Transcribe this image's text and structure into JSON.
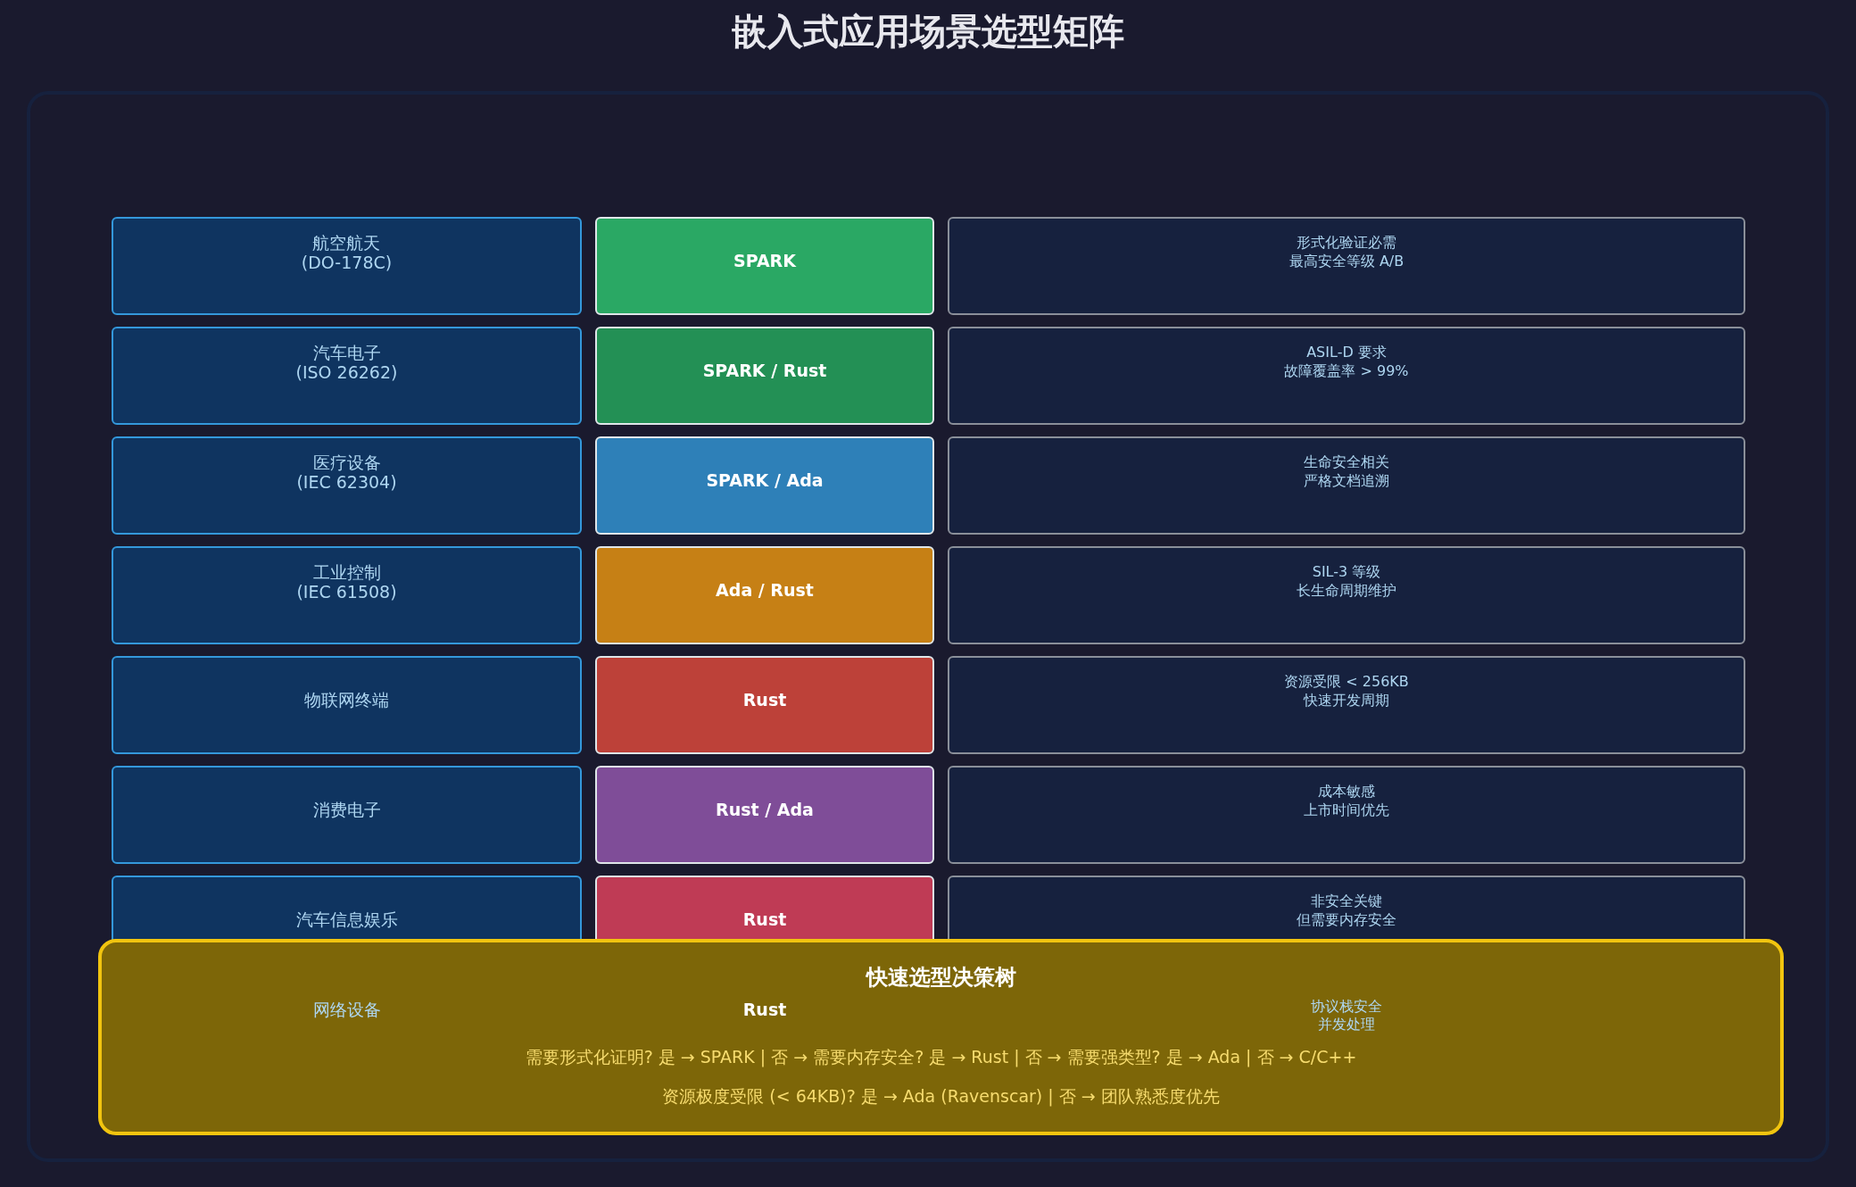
{
  "title": "嵌入式应用场景选型矩阵",
  "rows": [
    {
      "scenario": [
        "航空航天",
        "(DO-178C)"
      ],
      "choice": "SPARK",
      "color": "#2aa864",
      "notes": [
        "形式化验证必需",
        "最高安全等级 A/B"
      ]
    },
    {
      "scenario": [
        "汽车电子",
        "(ISO 26262)"
      ],
      "choice": "SPARK / Rust",
      "color": "#239055",
      "notes": [
        "ASIL-D 要求",
        "故障覆盖率 > 99%"
      ]
    },
    {
      "scenario": [
        "医疗设备",
        "(IEC 62304)"
      ],
      "choice": "SPARK / Ada",
      "color": "#2e80b8",
      "notes": [
        "生命安全相关",
        "严格文档追溯"
      ]
    },
    {
      "scenario": [
        "工业控制",
        "(IEC 61508)"
      ],
      "choice": "Ada / Rust",
      "color": "#c68015",
      "notes": [
        "SIL-3 等级",
        "长生命周期维护"
      ]
    },
    {
      "scenario": [
        "物联网终端"
      ],
      "choice": "Rust",
      "color": "#bd4139",
      "notes": [
        "资源受限 < 256KB",
        "快速开发周期"
      ]
    },
    {
      "scenario": [
        "消费电子"
      ],
      "choice": "Rust / Ada",
      "color": "#7f4d98",
      "notes": [
        "成本敏感",
        "上市时间优先"
      ]
    },
    {
      "scenario": [
        "汽车信息娱乐"
      ],
      "choice": "Rust",
      "color": "#bf3b55",
      "notes": [
        "非安全关键",
        "但需要内存安全"
      ]
    },
    {
      "scenario": [
        "网络设备"
      ],
      "choice": "Rust",
      "notes": [
        "协议栈安全",
        "并发处理"
      ]
    }
  ],
  "decision_tree": {
    "title": "快速选型决策树",
    "lines": [
      "需要形式化证明? 是 → SPARK | 否 → 需要内存安全? 是 → Rust | 否 → 需要强类型? 是 → Ada | 否 → C/C++",
      "资源极度受限 (< 64KB)? 是 → Ada (Ravenscar) | 否 → 团队熟悉度优先"
    ]
  }
}
